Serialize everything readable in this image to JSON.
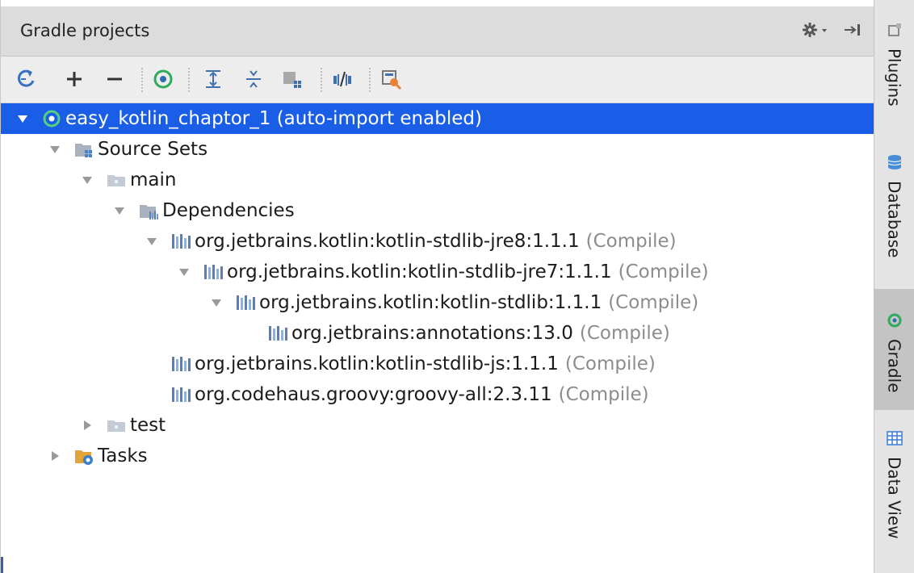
{
  "window": {
    "title": "Gradle projects"
  },
  "title_actions": [
    {
      "name": "settings-icon",
      "glyph": "gear-dropdown"
    },
    {
      "name": "hide-panel-icon",
      "glyph": "arrow-to-right-bar"
    }
  ],
  "toolbar": {
    "buttons": [
      {
        "name": "refresh-all-projects-button",
        "icon": "refresh-icon"
      },
      {
        "name": "add-project-button",
        "icon": "plus-icon"
      },
      {
        "name": "remove-project-button",
        "icon": "minus-icon"
      },
      {
        "name": "execute-task-button",
        "icon": "gradle-run-icon"
      },
      {
        "name": "expand-all-button",
        "icon": "expand-all-icon"
      },
      {
        "name": "collapse-all-button",
        "icon": "collapse-all-icon"
      },
      {
        "name": "group-modules-button",
        "icon": "group-modules-icon"
      },
      {
        "name": "toggle-offline-button",
        "icon": "offline-mode-icon"
      },
      {
        "name": "gradle-settings-button",
        "icon": "build-settings-icon"
      }
    ]
  },
  "tree": {
    "root": {
      "label": "easy_kotlin_chaptor_1 (auto-import enabled)",
      "expanded": true,
      "icon": "gradle-project-icon"
    },
    "source_sets": {
      "label": "Source Sets",
      "expanded": true,
      "icon": "source-sets-folder-icon"
    },
    "main": {
      "label": "main",
      "expanded": true,
      "icon": "folder-icon"
    },
    "dependencies": {
      "label": "Dependencies",
      "expanded": true,
      "icon": "dependencies-folder-icon"
    },
    "deps": [
      {
        "label": "org.jetbrains.kotlin:kotlin-stdlib-jre8:1.1.1",
        "scope": "(Compile)",
        "expanded": true
      },
      {
        "label": "org.jetbrains.kotlin:kotlin-stdlib-jre7:1.1.1",
        "scope": "(Compile)",
        "expanded": true
      },
      {
        "label": "org.jetbrains.kotlin:kotlin-stdlib:1.1.1",
        "scope": "(Compile)",
        "expanded": true
      },
      {
        "label": "org.jetbrains:annotations:13.0",
        "scope": "(Compile)",
        "expanded": false
      },
      {
        "label": "org.jetbrains.kotlin:kotlin-stdlib-js:1.1.1",
        "scope": "(Compile)",
        "expanded": false
      },
      {
        "label": "org.codehaus.groovy:groovy-all:2.3.11",
        "scope": "(Compile)",
        "expanded": false
      }
    ],
    "test": {
      "label": "test",
      "expanded": false,
      "icon": "folder-icon"
    },
    "tasks": {
      "label": "Tasks",
      "expanded": false,
      "icon": "tasks-folder-icon"
    }
  },
  "sidebar": {
    "tabs": [
      {
        "label": "Plugins",
        "icon": "plugins-icon",
        "active": false
      },
      {
        "label": "Database",
        "icon": "database-icon",
        "active": false
      },
      {
        "label": "Gradle",
        "icon": "gradle-icon",
        "active": true
      },
      {
        "label": "Data View",
        "icon": "data-view-icon",
        "active": false
      }
    ]
  },
  "colors": {
    "selection": "#1a5ee8",
    "gradle_green": "#2eaa5a",
    "muted_text": "#8c8c8c",
    "library_icon": "#5b7fb5"
  }
}
